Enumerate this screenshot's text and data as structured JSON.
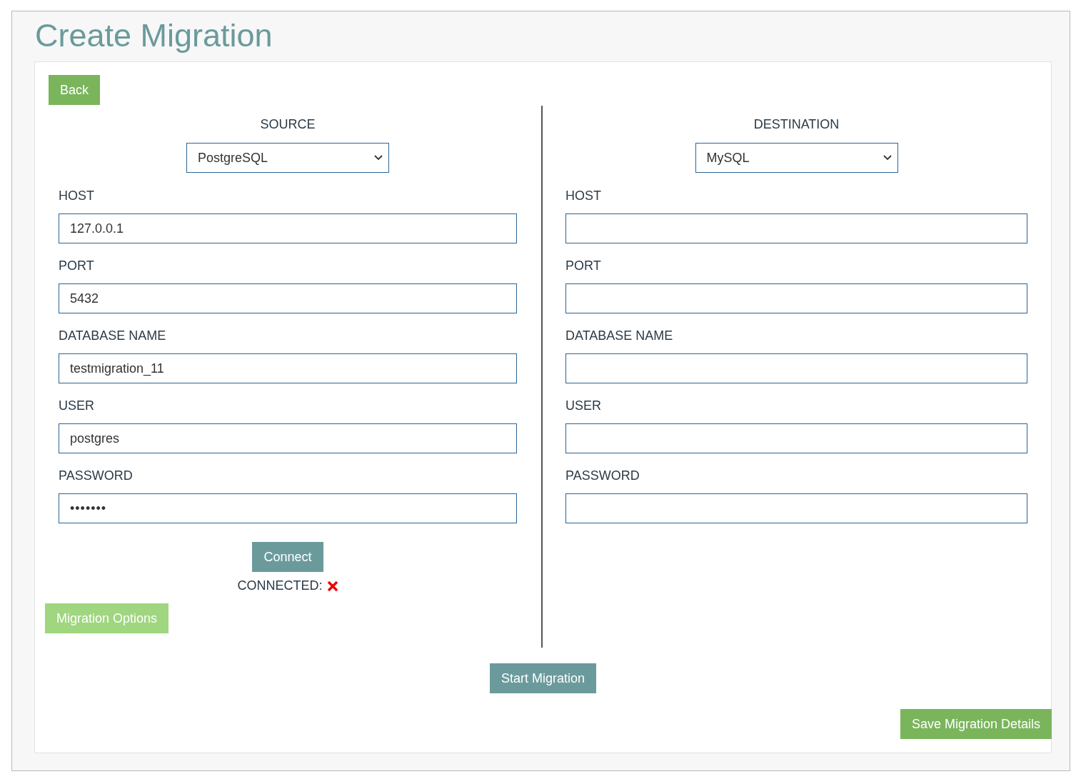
{
  "page": {
    "title": "Create Migration"
  },
  "back_button": "Back",
  "source": {
    "heading": "SOURCE",
    "database_type": "PostgreSQL",
    "fields": [
      {
        "label": "HOST",
        "value": "127.0.0.1",
        "kind": "text"
      },
      {
        "label": "PORT",
        "value": "5432",
        "kind": "text"
      },
      {
        "label": "DATABASE NAME",
        "value": "testmigration_11",
        "kind": "text"
      },
      {
        "label": "USER",
        "value": "postgres",
        "kind": "text"
      },
      {
        "label": "PASSWORD",
        "value": "•••••••",
        "kind": "password"
      }
    ],
    "connect_button": "Connect",
    "status_label": "CONNECTED:",
    "connected": false
  },
  "destination": {
    "heading": "DESTINATION",
    "database_type": "MySQL",
    "fields": [
      {
        "label": "HOST"
      },
      {
        "label": "PORT"
      },
      {
        "label": "DATABASE NAME"
      },
      {
        "label": "USER"
      },
      {
        "label": "PASSWORD"
      }
    ]
  },
  "migration_options_button": {
    "label": "Migration Options",
    "disabled": true
  },
  "start_button": "Start Migration",
  "save_button": "Save Migration Details"
}
